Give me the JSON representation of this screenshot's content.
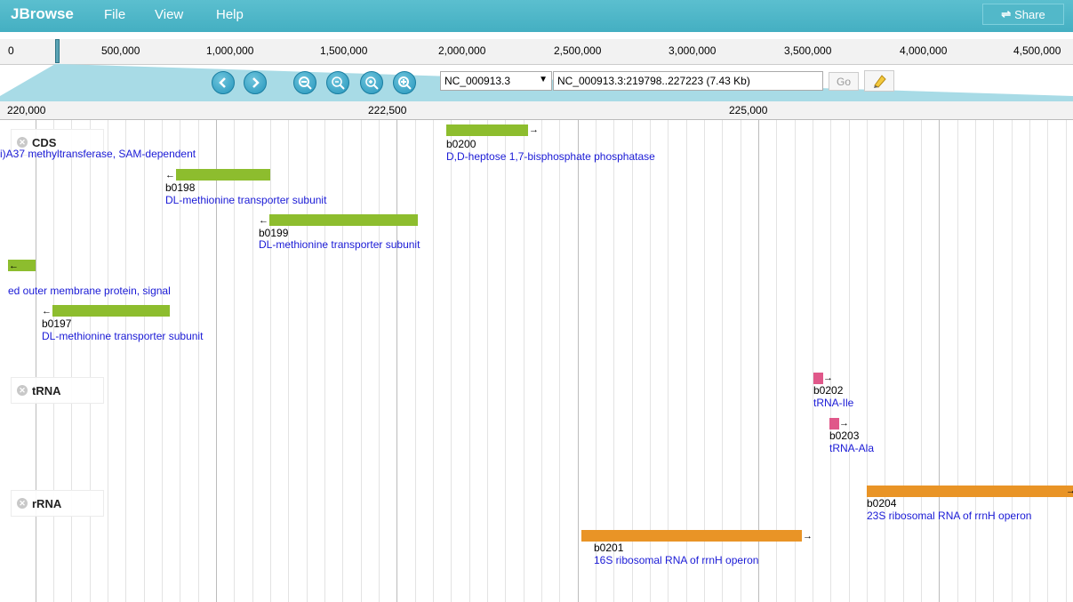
{
  "app": {
    "brand": "JBrowse",
    "menus": [
      "File",
      "View",
      "Help"
    ],
    "share_label": "Share"
  },
  "overview": {
    "ticks": [
      "0",
      "500,000",
      "1,000,000",
      "1,500,000",
      "2,000,000",
      "2,500,000",
      "3,000,000",
      "3,500,000",
      "4,000,000",
      "4,500,000"
    ]
  },
  "nav": {
    "sequence": "NC_000913.3",
    "location": "NC_000913.3:219798..227223 (7.43 Kb)",
    "go_label": "Go"
  },
  "ruler": {
    "ticks": [
      "220,000",
      "222,500",
      "225,000"
    ]
  },
  "tracks": {
    "cds": "CDS",
    "trna": "tRNA",
    "rrna": "rRNA"
  },
  "features": {
    "cds_partial_top": "i)A37 methyltransferase, SAM-dependent",
    "b0200_name": "b0200",
    "b0200_desc": "D,D-heptose 1,7-bisphosphate phosphatase",
    "b0198_name": "b0198",
    "b0198_desc": "DL-methionine transporter subunit",
    "b0199_name": "b0199",
    "b0199_desc": "DL-methionine transporter subunit",
    "cds_partial_mid": "ed outer membrane protein, signal",
    "b0197_name": "b0197",
    "b0197_desc": "DL-methionine transporter subunit",
    "b0202_name": "b0202",
    "b0202_desc": "tRNA-Ile",
    "b0203_name": "b0203",
    "b0203_desc": "tRNA-Ala",
    "b0204_name": "b0204",
    "b0204_desc": "23S ribosomal RNA of rrnH operon",
    "b0201_name": "b0201",
    "b0201_desc": "16S ribosomal RNA of rrnH operon"
  },
  "icons": {
    "zoom_out_more": "zoom-out-more-icon",
    "zoom_out": "zoom-out-icon",
    "zoom_in": "zoom-in-icon",
    "zoom_in_more": "zoom-in-more-icon"
  }
}
